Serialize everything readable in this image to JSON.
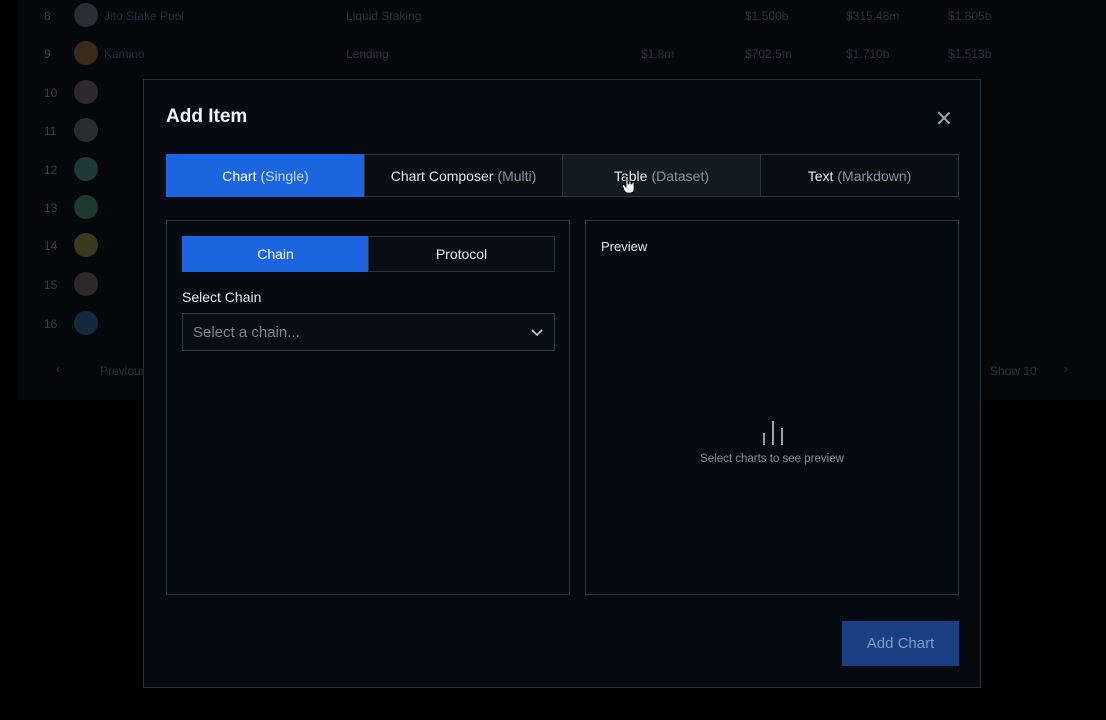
{
  "background_table": {
    "rows": [
      {
        "index": "8",
        "name": "Jito Stake Pool",
        "category": "Liquid Staking",
        "c1": "",
        "c2": "$1.500b",
        "c3": "$315.48m",
        "c4": "$1.805b"
      },
      {
        "index": "9",
        "name": "Kamino",
        "category": "Lending",
        "c1": "$1.8m",
        "c2": "$702.5m",
        "c3": "$1.710b",
        "c4": "$1.513b"
      },
      {
        "index": "10",
        "name": "",
        "category": "",
        "c1": "",
        "c2": "",
        "c3": "",
        "c4": ""
      },
      {
        "index": "11",
        "name": "",
        "category": "",
        "c1": "",
        "c2": "",
        "c3": "",
        "c4": ""
      },
      {
        "index": "12",
        "name": "",
        "category": "",
        "c1": "",
        "c2": "",
        "c3": "",
        "c4": ""
      },
      {
        "index": "13",
        "name": "",
        "category": "",
        "c1": "",
        "c2": "",
        "c3": "",
        "c4": ""
      },
      {
        "index": "14",
        "name": "",
        "category": "",
        "c1": "",
        "c2": "",
        "c3": "",
        "c4": ""
      },
      {
        "index": "15",
        "name": "",
        "category": "",
        "c1": "",
        "c2": "",
        "c3": "",
        "c4": ""
      },
      {
        "index": "16",
        "name": "",
        "category": "",
        "c1": "",
        "c2": "",
        "c3": "",
        "c4": ""
      }
    ],
    "footer": {
      "previous": "Previous",
      "page_size": "Show 10"
    }
  },
  "modal": {
    "title": "Add Item",
    "tabs": [
      {
        "label": "Chart",
        "sub": "(Single)",
        "active": true
      },
      {
        "label": "Chart Composer",
        "sub": "(Multi)",
        "active": false
      },
      {
        "label": "Table",
        "sub": "(Dataset)",
        "active": false
      },
      {
        "label": "Text",
        "sub": "(Markdown)",
        "active": false
      }
    ],
    "mode_toggle": {
      "chain": "Chain",
      "protocol": "Protocol",
      "selected": "Chain"
    },
    "select_chain": {
      "label": "Select Chain",
      "placeholder": "Select a chain..."
    },
    "preview": {
      "label": "Preview",
      "empty_text": "Select charts to see preview",
      "icon": "bar-chart-icon"
    },
    "primary_button": "Add Chart"
  },
  "colors": {
    "accent": "#1c64e0",
    "disabled_button": "#1a3f85",
    "modal_bg": "#070b0f",
    "border": "#2e343c"
  }
}
